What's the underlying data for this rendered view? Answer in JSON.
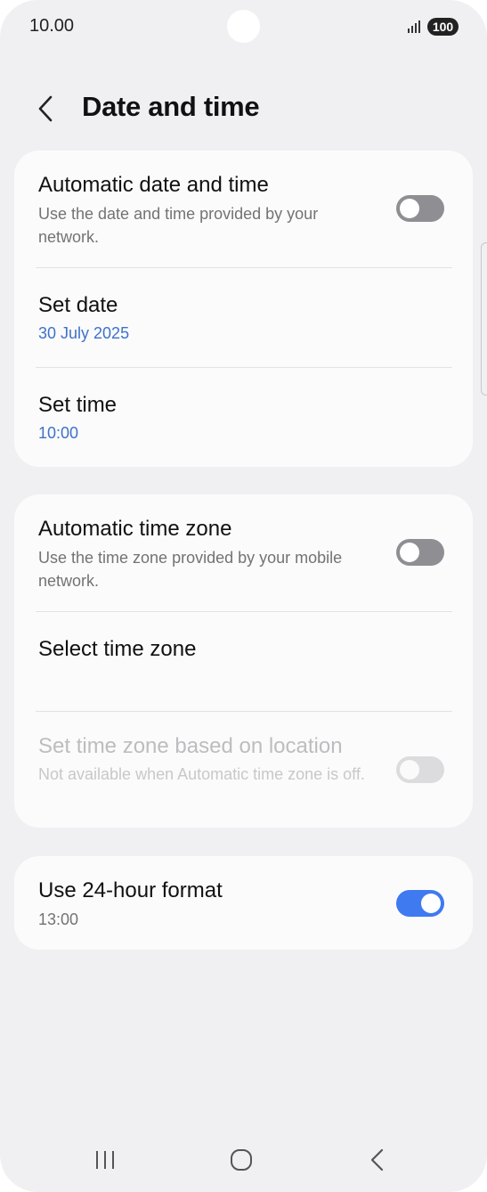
{
  "status_bar": {
    "time": "10.00",
    "battery": "100"
  },
  "header": {
    "title": "Date and time"
  },
  "sections": [
    {
      "items": [
        {
          "title": "Automatic date and time",
          "subtitle": "Use the date and time provided by your network.",
          "toggle": "off"
        },
        {
          "title": "Set date",
          "value": "30 July 2025"
        },
        {
          "title": "Set time",
          "value": "10:00"
        }
      ]
    },
    {
      "items": [
        {
          "title": "Automatic time zone",
          "subtitle": "Use the time zone provided by your mobile network.",
          "toggle": "off"
        },
        {
          "title": "Select time zone"
        },
        {
          "title": "Set time zone based on location",
          "subtitle": "Not available when Automatic time zone is off.",
          "toggle": "disabled"
        }
      ]
    },
    {
      "items": [
        {
          "title": "Use 24-hour format",
          "value": "13:00",
          "toggle": "on"
        }
      ]
    }
  ],
  "colors": {
    "accent": "#3f7af0",
    "link_value": "#3d72c9",
    "background": "#f0f0f2",
    "card": "#fbfbfc"
  },
  "icons": {
    "back": "chevron-left-icon",
    "nav_recents": "recents-icon",
    "nav_home": "home-icon",
    "nav_back": "back-icon"
  }
}
